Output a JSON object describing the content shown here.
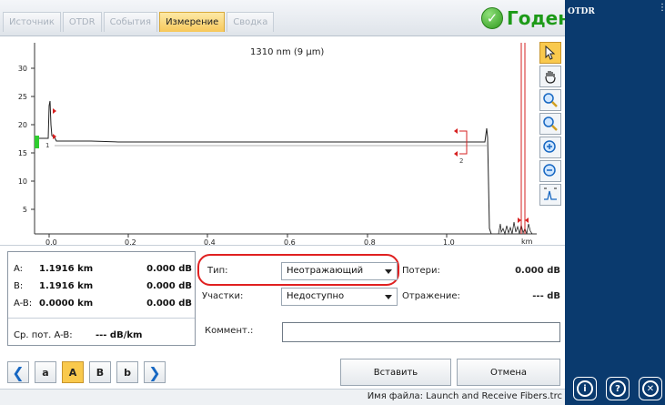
{
  "tabs": [
    {
      "label": "Источник",
      "active": false
    },
    {
      "label": "OTDR",
      "active": false
    },
    {
      "label": "События",
      "active": false
    },
    {
      "label": "Измерение",
      "active": true
    },
    {
      "label": "Сводка",
      "active": false
    }
  ],
  "status": {
    "label": "Годен",
    "icon": "checkmark-circle-icon",
    "color": "#1d9a18"
  },
  "sidebar": {
    "title": "OTDR",
    "bg": "#0a3a6e",
    "buttons": [
      {
        "icon": "info-icon"
      },
      {
        "icon": "help-icon"
      },
      {
        "icon": "close-icon"
      }
    ]
  },
  "graph": {
    "title": "1310 nm (9 µm)",
    "x_ticks": [
      "0.0",
      "0.2",
      "0.4",
      "0.6",
      "0.8",
      "1.0"
    ],
    "x_unit": "km",
    "y_ticks": [
      "5",
      "10",
      "15",
      "20",
      "25",
      "30"
    ],
    "marker_a_label": "1",
    "marker_b_label": "2"
  },
  "toolbar": [
    {
      "icon": "pointer-icon",
      "active": true
    },
    {
      "icon": "hand-pan-icon",
      "active": false
    },
    {
      "icon": "zoom-fit-icon",
      "active": false
    },
    {
      "icon": "zoom-area-icon",
      "active": false
    },
    {
      "icon": "zoom-in-icon",
      "active": false
    },
    {
      "icon": "zoom-out-icon",
      "active": false
    },
    {
      "icon": "zoom-full-trace-icon",
      "active": false
    }
  ],
  "results": {
    "a": {
      "label": "A:",
      "dist": "1.1916 km",
      "loss": "0.000 dB"
    },
    "b": {
      "label": "B:",
      "dist": "1.1916 km",
      "loss": "0.000 dB"
    },
    "ab": {
      "label": "A-B:",
      "dist": "0.0000 km",
      "loss": "0.000 dB"
    },
    "avg": {
      "label": "Ср. пот. A-B:",
      "value": "--- dB/km"
    }
  },
  "form": {
    "type_label": "Тип:",
    "type_value": "Неотражающий",
    "sections_label": "Участки:",
    "sections_value": "Недоступно",
    "loss_label": "Потери:",
    "loss_value": "0.000 dB",
    "reflect_label": "Отражение:",
    "reflect_value": "--- dB",
    "comment_label": "Коммент.:",
    "comment_value": ""
  },
  "nav": {
    "a_small": "a",
    "a_big": "A",
    "b_big": "B",
    "b_small": "b"
  },
  "buttons": {
    "insert": "Вставить",
    "cancel": "Отмена"
  },
  "footer": {
    "filename": "Имя файла: Launch and Receive Fibers.trc"
  }
}
